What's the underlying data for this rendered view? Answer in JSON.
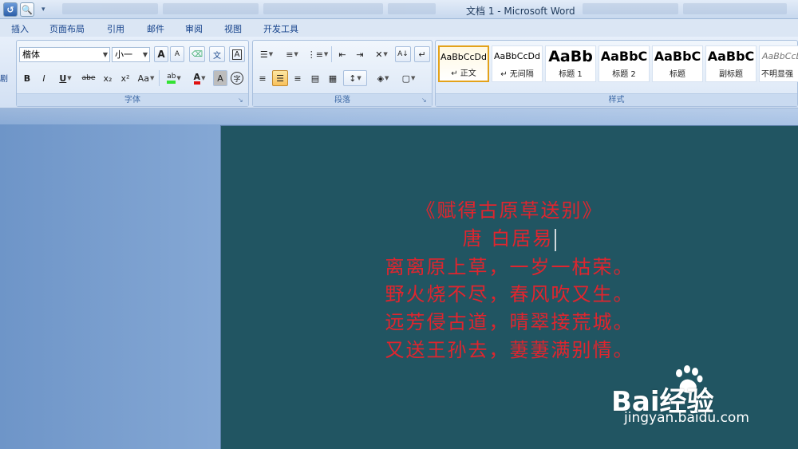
{
  "window": {
    "title": "文档 1 - Microsoft Word"
  },
  "menu": [
    "插入",
    "页面布局",
    "引用",
    "邮件",
    "审阅",
    "视图",
    "开发工具"
  ],
  "ribbon": {
    "left_label": "剧",
    "font_group": {
      "label": "字体",
      "font_name": "楷体",
      "font_size": "小一",
      "grow_font": "A",
      "shrink_font": "A",
      "bold": "B",
      "italic": "I",
      "underline": "U",
      "strike": "abe",
      "subscript": "x₂",
      "superscript": "x²",
      "change_case": "Aa",
      "highlight": "ab",
      "font_color": "A",
      "char_shade": "A",
      "enclose": "字",
      "phonetic": "文",
      "char_border": "A"
    },
    "paragraph_group": {
      "label": "段落"
    },
    "styles_group": {
      "label": "样式",
      "items": [
        {
          "sample": "AaBbCcDd",
          "name": "↵ 正文"
        },
        {
          "sample": "AaBbCcDd",
          "name": "↵ 无间隔"
        },
        {
          "sample": "AaBb",
          "name": "标题 1"
        },
        {
          "sample": "AaBbC",
          "name": "标题 2"
        },
        {
          "sample": "AaBbC",
          "name": "标题"
        },
        {
          "sample": "AaBbC",
          "name": "副标题"
        },
        {
          "sample": "AaBbCcD",
          "name": "不明显强"
        }
      ]
    }
  },
  "document": {
    "page_color": "#215562",
    "text_color": "#e0252e",
    "lines": [
      "《赋得古原草送别》",
      "唐  白居易",
      "离离原上草，一岁一枯荣。",
      "野火烧不尽，春风吹又生。",
      "远芳侵古道，晴翠接荒城。",
      "又送王孙去，萋萋满别情。"
    ]
  },
  "watermark": {
    "brand": "Bai经验",
    "url": "jingyan.baidu.com"
  }
}
